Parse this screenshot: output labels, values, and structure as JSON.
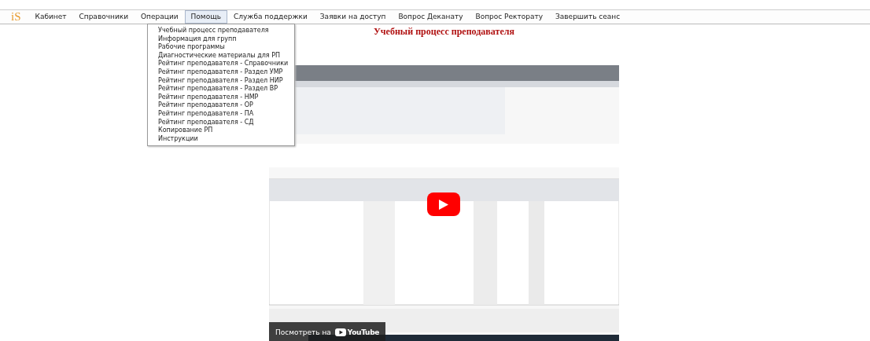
{
  "menu": {
    "logo": "iS",
    "items": [
      {
        "label": "Кабинет",
        "selected": false
      },
      {
        "label": "Справочники",
        "selected": false
      },
      {
        "label": "Операции",
        "selected": false
      },
      {
        "label": "Помощь",
        "selected": true
      },
      {
        "label": "Служба поддержки",
        "selected": false
      },
      {
        "label": "Заявки на доступ",
        "selected": false
      },
      {
        "label": "Вопрос Деканату",
        "selected": false
      },
      {
        "label": "Вопрос Ректорату",
        "selected": false
      },
      {
        "label": "Завершить сеанс",
        "selected": false
      }
    ]
  },
  "dropdown": {
    "items": [
      "Учебный процесс преподавателя",
      "Информация для групп",
      "Рабочие программы",
      "Диагностические материалы для РП",
      "Рейтинг преподавателя - Справочники",
      "Рейтинг преподавателя - Раздел УМР",
      "Рейтинг преподавателя - Раздел НИР",
      "Рейтинг преподавателя - Раздел ВР",
      "Рейтинг преподавателя - НМР",
      "Рейтинг преподавателя - ОР",
      "Рейтинг преподавателя - ПА",
      "Рейтинг преподавателя - СД",
      "Копирование РП",
      "Инструкции"
    ]
  },
  "page_title": "Учебный процесс преподавателя",
  "video": {
    "kind": "picture",
    "watch_label": "Посмотреть на",
    "brand": "YouTube"
  }
}
